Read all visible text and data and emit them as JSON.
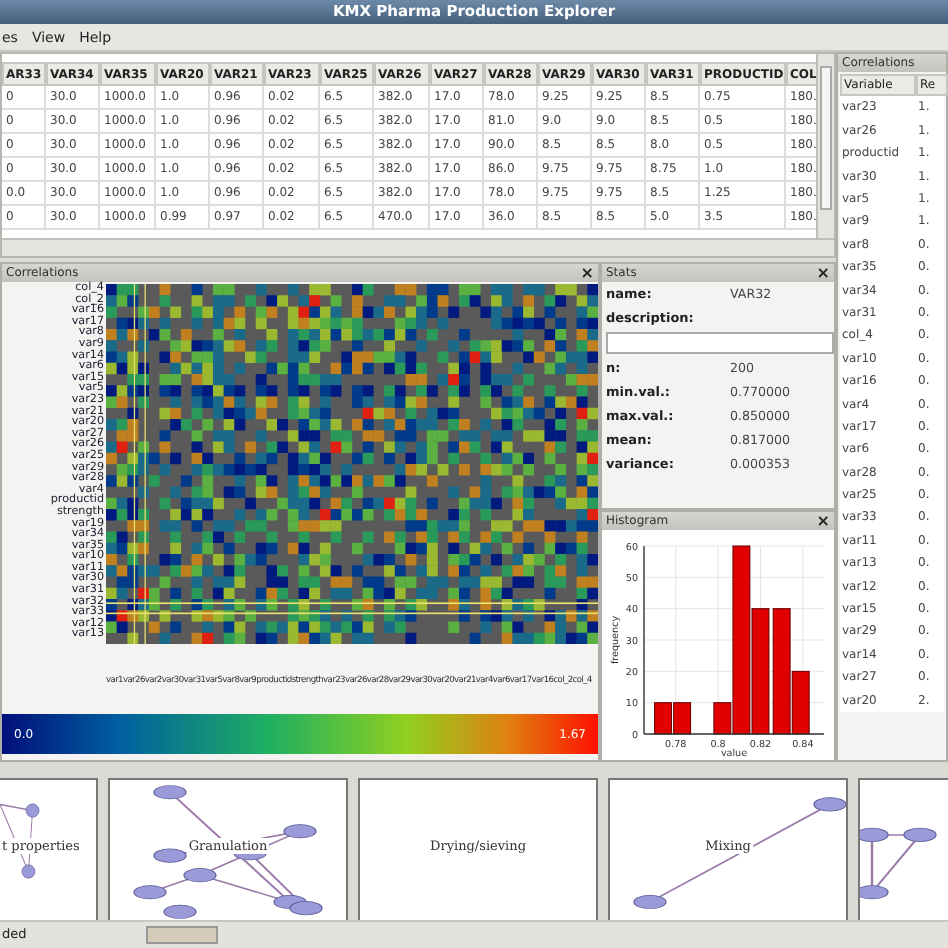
{
  "window": {
    "title": "KMX Pharma Production Explorer"
  },
  "menu": [
    "es",
    "View",
    "Help"
  ],
  "table": {
    "columns": [
      "AR33",
      "VAR34",
      "VAR35",
      "VAR20",
      "VAR21",
      "VAR23",
      "VAR25",
      "VAR26",
      "VAR27",
      "VAR28",
      "VAR29",
      "VAR30",
      "VAR31",
      "PRODUCTID",
      "COL"
    ],
    "rows": [
      [
        "0",
        "30.0",
        "1000.0",
        "1.0",
        "0.96",
        "0.02",
        "6.5",
        "382.0",
        "17.0",
        "78.0",
        "9.25",
        "9.25",
        "8.5",
        "0.75",
        "180."
      ],
      [
        "0",
        "30.0",
        "1000.0",
        "1.0",
        "0.96",
        "0.02",
        "6.5",
        "382.0",
        "17.0",
        "81.0",
        "9.0",
        "9.0",
        "8.5",
        "0.5",
        "180."
      ],
      [
        "0",
        "30.0",
        "1000.0",
        "1.0",
        "0.96",
        "0.02",
        "6.5",
        "382.0",
        "17.0",
        "90.0",
        "8.5",
        "8.5",
        "8.0",
        "0.5",
        "180."
      ],
      [
        "0",
        "30.0",
        "1000.0",
        "1.0",
        "0.96",
        "0.02",
        "6.5",
        "382.0",
        "17.0",
        "86.0",
        "9.75",
        "9.75",
        "8.75",
        "1.0",
        "180."
      ],
      [
        "0.0",
        "30.0",
        "1000.0",
        "1.0",
        "0.96",
        "0.02",
        "6.5",
        "382.0",
        "17.0",
        "78.0",
        "9.75",
        "9.75",
        "8.5",
        "1.25",
        "180."
      ],
      [
        "0",
        "30.0",
        "1000.0",
        "0.99",
        "0.97",
        "0.02",
        "6.5",
        "470.0",
        "17.0",
        "36.0",
        "8.5",
        "8.5",
        "5.0",
        "3.5",
        "180."
      ]
    ]
  },
  "correlations": {
    "title": "Correlations",
    "close": "×",
    "rows": [
      "col_4",
      "col_2",
      "var16",
      "var17",
      "var8",
      "var9",
      "var14",
      "var6",
      "var15",
      "var5",
      "var23",
      "var21",
      "var20",
      "var27",
      "var26",
      "var25",
      "var29",
      "var28",
      "var4",
      "productid",
      "strength",
      "var19",
      "var34",
      "var35",
      "var10",
      "var11",
      "var30",
      "var31",
      "var32",
      "var33",
      "var12",
      "var13"
    ],
    "x_labels": "var1var26var2var30var31var5var8var9productidstrengthvar23var26var28var29var30var20var21var4var6var17var16col_2col_4",
    "scale_min": "0.0",
    "scale_max": "1.67"
  },
  "stats": {
    "title": "Stats",
    "close": "×",
    "fields": [
      {
        "label": "name:",
        "value": "VAR32"
      },
      {
        "label": "description:"
      }
    ],
    "numbers": [
      {
        "label": "n:",
        "value": "200"
      },
      {
        "label": "min.val.:",
        "value": "0.770000"
      },
      {
        "label": "max.val.:",
        "value": "0.850000"
      },
      {
        "label": "mean:",
        "value": "0.817000"
      },
      {
        "label": "variance:",
        "value": "0.000353"
      }
    ]
  },
  "histogram": {
    "title": "Histogram",
    "close": "×",
    "chart_data": {
      "type": "bar",
      "xlabel": "value",
      "ylabel": "frequency",
      "x": [
        0.774,
        0.783,
        0.802,
        0.811,
        0.82,
        0.83,
        0.839
      ],
      "values": [
        10,
        10,
        10,
        60,
        40,
        40,
        20
      ],
      "xlim": [
        0.765,
        0.85
      ],
      "ylim": [
        0,
        60
      ],
      "xticks": [
        0.78,
        0.8,
        0.82,
        0.84
      ],
      "grid": true,
      "yticks": [
        0,
        10,
        20,
        30,
        40,
        50,
        60
      ]
    }
  },
  "side_list": {
    "title": "Correlations",
    "columns": [
      "Variable",
      "Re"
    ],
    "rows": [
      [
        "var23",
        "1."
      ],
      [
        "var26",
        "1."
      ],
      [
        "productid",
        "1."
      ],
      [
        "var30",
        "1."
      ],
      [
        "var5",
        "1."
      ],
      [
        "var9",
        "1."
      ],
      [
        "var8",
        "0."
      ],
      [
        "var35",
        "0."
      ],
      [
        "var34",
        "0."
      ],
      [
        "var31",
        "0."
      ],
      [
        "col_4",
        "0."
      ],
      [
        "var10",
        "0."
      ],
      [
        "var16",
        "0."
      ],
      [
        "var4",
        "0."
      ],
      [
        "var17",
        "0."
      ],
      [
        "var6",
        "0."
      ],
      [
        "var28",
        "0."
      ],
      [
        "var25",
        "0."
      ],
      [
        "var33",
        "0."
      ],
      [
        "var11",
        "0."
      ],
      [
        "var13",
        "0."
      ],
      [
        "var12",
        "0."
      ],
      [
        "var15",
        "0."
      ],
      [
        "var29",
        "0."
      ],
      [
        "var14",
        "0."
      ],
      [
        "var27",
        "0."
      ],
      [
        "var20",
        "2."
      ]
    ]
  },
  "process_panels": [
    {
      "kind": "network",
      "label": "t properties"
    },
    {
      "kind": "network",
      "label": "Granulation"
    },
    {
      "kind": "empty",
      "label": "Drying/sieving"
    },
    {
      "kind": "network",
      "label": "Mixing"
    },
    {
      "kind": "network"
    }
  ],
  "status_bar": {
    "text": "ded"
  }
}
